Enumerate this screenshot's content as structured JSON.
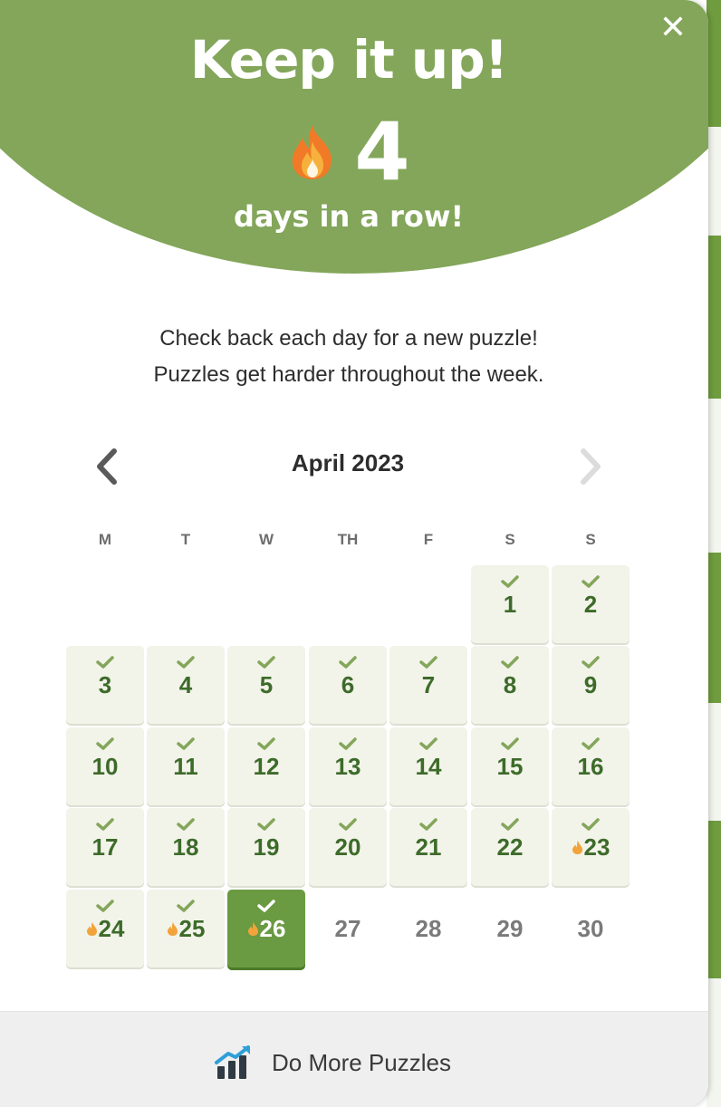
{
  "colors": {
    "header_green": "#83a65a",
    "done_cell": "#f2f3e9",
    "today_cell": "#6a9a41",
    "day_text_green": "#3d6b2a",
    "future_text": "#7a7a7a"
  },
  "header": {
    "title": "Keep it up!",
    "streak_icon": "fire-icon",
    "streak_count": "4",
    "streak_label": "days in a row!",
    "close_icon": "close-icon",
    "close_glyph": "✕"
  },
  "message": {
    "line1": "Check back each day for a new puzzle!",
    "line2": "Puzzles get harder throughout the week."
  },
  "calendar": {
    "month_label": "April 2023",
    "prev_icon": "chevron-left-icon",
    "next_icon": "chevron-right-icon",
    "weekdays": [
      "M",
      "T",
      "W",
      "TH",
      "F",
      "S",
      "S"
    ],
    "days": [
      {
        "label": "1",
        "status": "done",
        "streak": false
      },
      {
        "label": "2",
        "status": "done",
        "streak": false
      },
      {
        "label": "3",
        "status": "done",
        "streak": false
      },
      {
        "label": "4",
        "status": "done",
        "streak": false
      },
      {
        "label": "5",
        "status": "done",
        "streak": false
      },
      {
        "label": "6",
        "status": "done",
        "streak": false
      },
      {
        "label": "7",
        "status": "done",
        "streak": false
      },
      {
        "label": "8",
        "status": "done",
        "streak": false
      },
      {
        "label": "9",
        "status": "done",
        "streak": false
      },
      {
        "label": "10",
        "status": "done",
        "streak": false
      },
      {
        "label": "11",
        "status": "done",
        "streak": false
      },
      {
        "label": "12",
        "status": "done",
        "streak": false
      },
      {
        "label": "13",
        "status": "done",
        "streak": false
      },
      {
        "label": "14",
        "status": "done",
        "streak": false
      },
      {
        "label": "15",
        "status": "done",
        "streak": false
      },
      {
        "label": "16",
        "status": "done",
        "streak": false
      },
      {
        "label": "17",
        "status": "done",
        "streak": false
      },
      {
        "label": "18",
        "status": "done",
        "streak": false
      },
      {
        "label": "19",
        "status": "done",
        "streak": false
      },
      {
        "label": "20",
        "status": "done",
        "streak": false
      },
      {
        "label": "21",
        "status": "done",
        "streak": false
      },
      {
        "label": "22",
        "status": "done",
        "streak": false
      },
      {
        "label": "23",
        "status": "done",
        "streak": true
      },
      {
        "label": "24",
        "status": "done",
        "streak": true
      },
      {
        "label": "25",
        "status": "done",
        "streak": true
      },
      {
        "label": "26",
        "status": "today",
        "streak": true
      },
      {
        "label": "27",
        "status": "future",
        "streak": false
      },
      {
        "label": "28",
        "status": "future",
        "streak": false
      },
      {
        "label": "29",
        "status": "future",
        "streak": false
      },
      {
        "label": "30",
        "status": "future",
        "streak": false
      }
    ]
  },
  "footer": {
    "icon": "bar-chart-icon",
    "label": "Do More Puzzles"
  }
}
